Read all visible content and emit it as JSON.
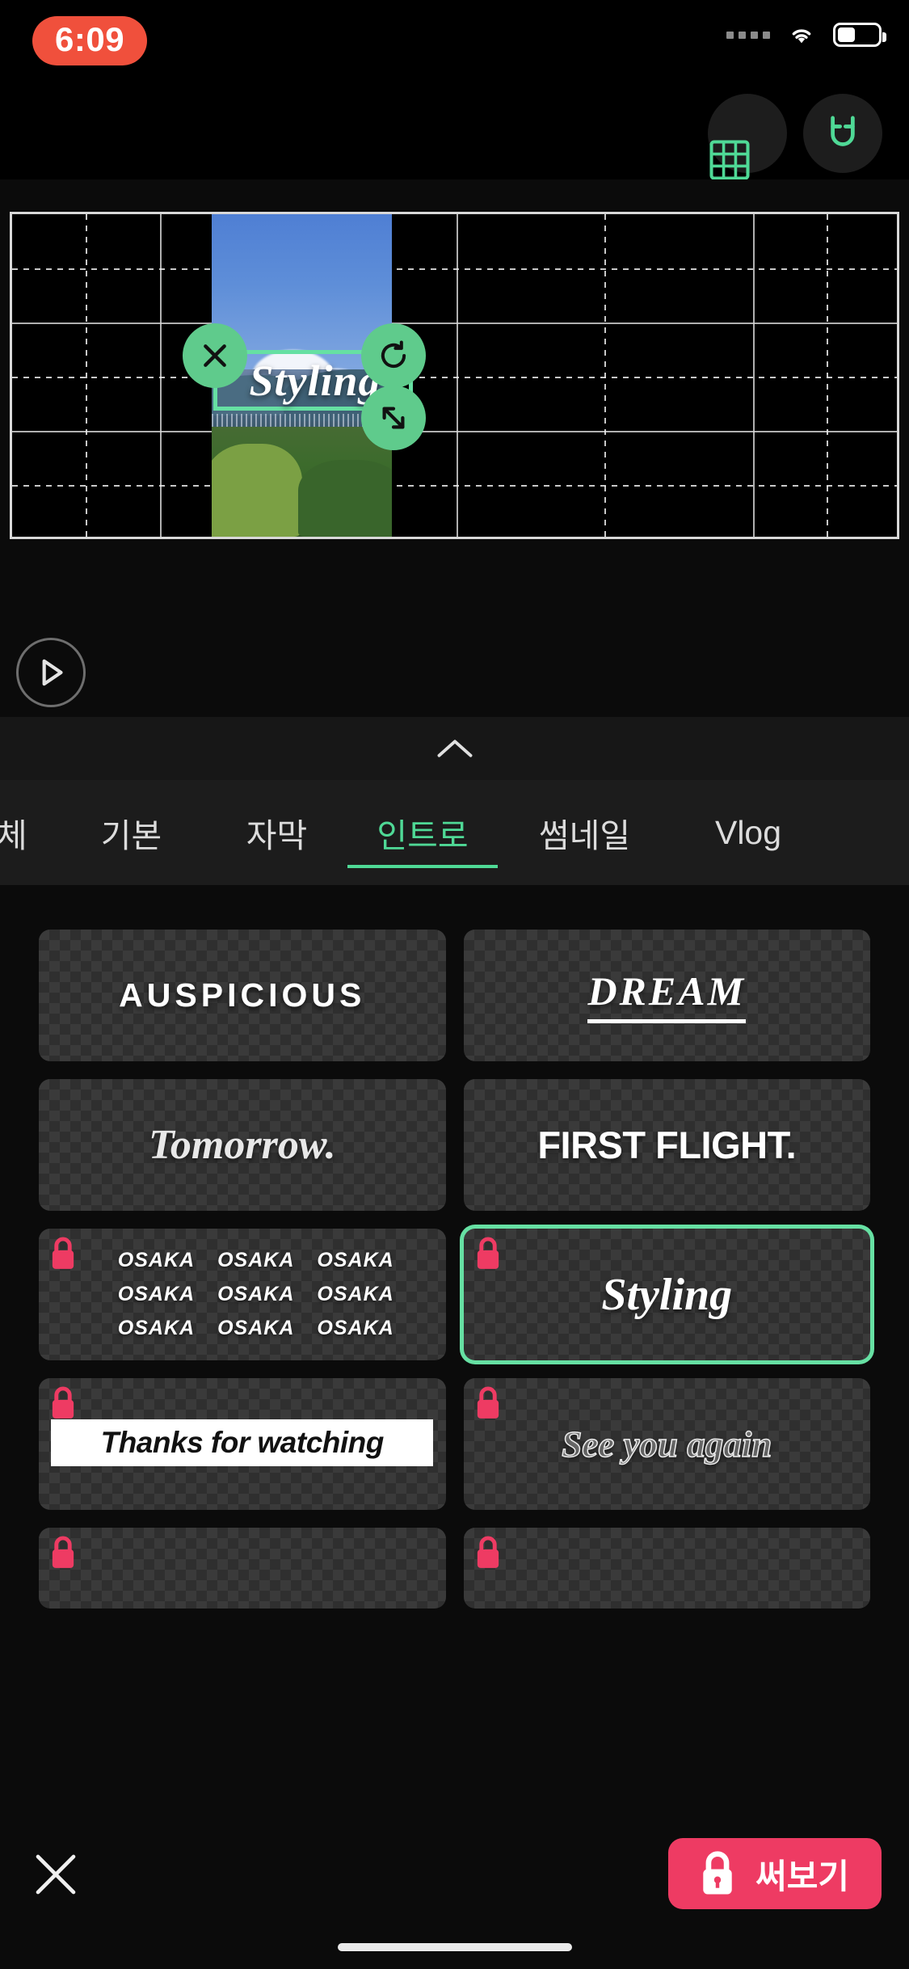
{
  "status_bar": {
    "time": "6:09",
    "time_pill_color": "#F0503C",
    "icons": [
      "signal-dots-icon",
      "wifi-icon",
      "battery-icon"
    ]
  },
  "toolbar": {
    "grid_icon": "grid-icon",
    "magnet_icon": "magnet-icon",
    "accent_color": "#4fd996"
  },
  "canvas": {
    "overlay_text": "Styling",
    "selection_color": "#66e0a3",
    "handles": [
      {
        "name": "delete-handle",
        "icon": "close-icon"
      },
      {
        "name": "rotate-handle",
        "icon": "rotate-icon"
      },
      {
        "name": "resize-handle",
        "icon": "resize-diagonal-icon"
      }
    ],
    "grid_overlay": "on",
    "play_icon": "play-icon"
  },
  "collapse_bar": {
    "icon": "chevron-up-icon"
  },
  "tabs": [
    {
      "label": "체",
      "active": false
    },
    {
      "label": "기본",
      "active": false
    },
    {
      "label": "자막",
      "active": false
    },
    {
      "label": "인트로",
      "active": true
    },
    {
      "label": "썸네일",
      "active": false
    },
    {
      "label": "Vlog",
      "active": false
    }
  ],
  "templates": [
    {
      "id": "auspicious",
      "label": "AUSPICIOUS",
      "locked": false,
      "selected": false
    },
    {
      "id": "dream",
      "label": "DREAM",
      "locked": false,
      "selected": false
    },
    {
      "id": "tomorrow",
      "label": "Tomorrow.",
      "locked": false,
      "selected": false
    },
    {
      "id": "first-flight",
      "label": "FIRST FLIGHT.",
      "locked": false,
      "selected": false
    },
    {
      "id": "osaka",
      "label": "OSAKA",
      "locked": true,
      "selected": false,
      "repeat_labels": [
        "OSAKA",
        "OSAKA",
        "OSAKA",
        "OSAKA",
        "OSAKA",
        "OSAKA",
        "OSAKA",
        "OSAKA",
        "OSAKA"
      ]
    },
    {
      "id": "styling",
      "label": "Styling",
      "locked": true,
      "selected": true
    },
    {
      "id": "thanks",
      "label": "Thanks for watching",
      "locked": true,
      "selected": false
    },
    {
      "id": "see-you",
      "label": "See you again",
      "locked": true,
      "selected": false
    },
    {
      "id": "partial-left",
      "label": "",
      "locked": true,
      "selected": false
    },
    {
      "id": "partial-right",
      "label": "",
      "locked": true,
      "selected": false
    }
  ],
  "action_bar": {
    "close_icon": "close-icon",
    "try_button_label": "써보기",
    "try_button_icon": "lock-icon",
    "try_button_color": "#EE3B63"
  }
}
